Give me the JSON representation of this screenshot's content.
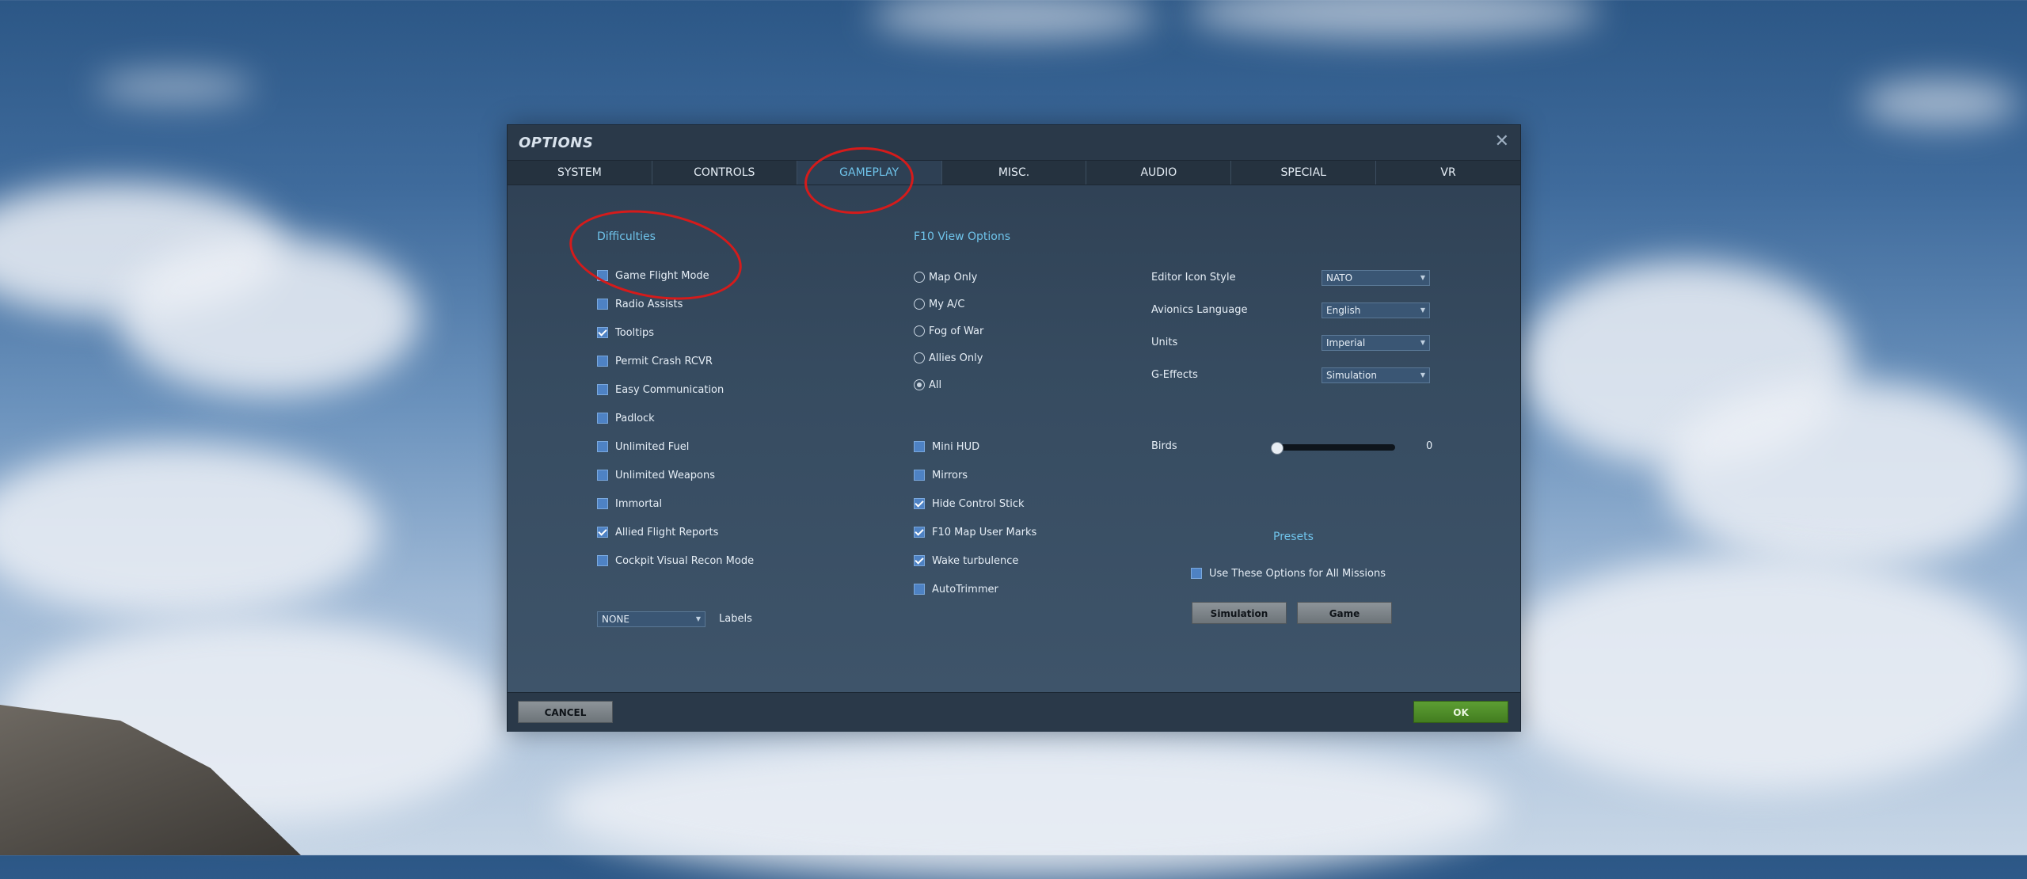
{
  "dialog": {
    "title": "OPTIONS",
    "close_icon": "close-icon"
  },
  "tabs": [
    {
      "label": "SYSTEM"
    },
    {
      "label": "CONTROLS"
    },
    {
      "label": "GAMEPLAY",
      "active": true
    },
    {
      "label": "MISC."
    },
    {
      "label": "AUDIO"
    },
    {
      "label": "SPECIAL"
    },
    {
      "label": "VR"
    }
  ],
  "difficulties": {
    "title": "Difficulties",
    "items": [
      {
        "label": "Game Flight Mode",
        "checked": false
      },
      {
        "label": "Radio Assists",
        "checked": false
      },
      {
        "label": "Tooltips",
        "checked": true
      },
      {
        "label": "Permit Crash RCVR",
        "checked": false
      },
      {
        "label": "Easy Communication",
        "checked": false
      },
      {
        "label": "Padlock",
        "checked": false
      },
      {
        "label": "Unlimited Fuel",
        "checked": false
      },
      {
        "label": "Unlimited Weapons",
        "checked": false
      },
      {
        "label": "Immortal",
        "checked": false
      },
      {
        "label": "Allied Flight Reports",
        "checked": true
      },
      {
        "label": "Cockpit Visual Recon Mode",
        "checked": false
      }
    ],
    "labels_select": "NONE",
    "labels_caption": "Labels"
  },
  "f10": {
    "title": "F10 View Options",
    "radios": [
      {
        "label": "Map Only",
        "checked": false
      },
      {
        "label": "My A/C",
        "checked": false
      },
      {
        "label": "Fog of War",
        "checked": false
      },
      {
        "label": "Allies Only",
        "checked": false
      },
      {
        "label": "All",
        "checked": true
      }
    ],
    "checks": [
      {
        "label": "Mini HUD",
        "checked": false
      },
      {
        "label": "Mirrors",
        "checked": false
      },
      {
        "label": "Hide Control Stick",
        "checked": true
      },
      {
        "label": "F10 Map User Marks",
        "checked": true
      },
      {
        "label": "Wake turbulence",
        "checked": true
      },
      {
        "label": "AutoTrimmer",
        "checked": false
      }
    ]
  },
  "settings": [
    {
      "label": "Editor Icon Style",
      "value": "NATO"
    },
    {
      "label": "Avionics Language",
      "value": "English"
    },
    {
      "label": "Units",
      "value": "Imperial"
    },
    {
      "label": "G-Effects",
      "value": "Simulation"
    }
  ],
  "birds": {
    "label": "Birds",
    "value": "0",
    "level": 0
  },
  "presets": {
    "title": "Presets",
    "use_label": "Use These Options for All Missions",
    "use_checked": false,
    "simulation_label": "Simulation",
    "game_label": "Game"
  },
  "footer": {
    "cancel_label": "CANCEL",
    "ok_label": "OK"
  },
  "colors": {
    "accent": "#6fc3ea",
    "ok_green": "#4a8a25",
    "annotation_red": "#d51b1b"
  }
}
